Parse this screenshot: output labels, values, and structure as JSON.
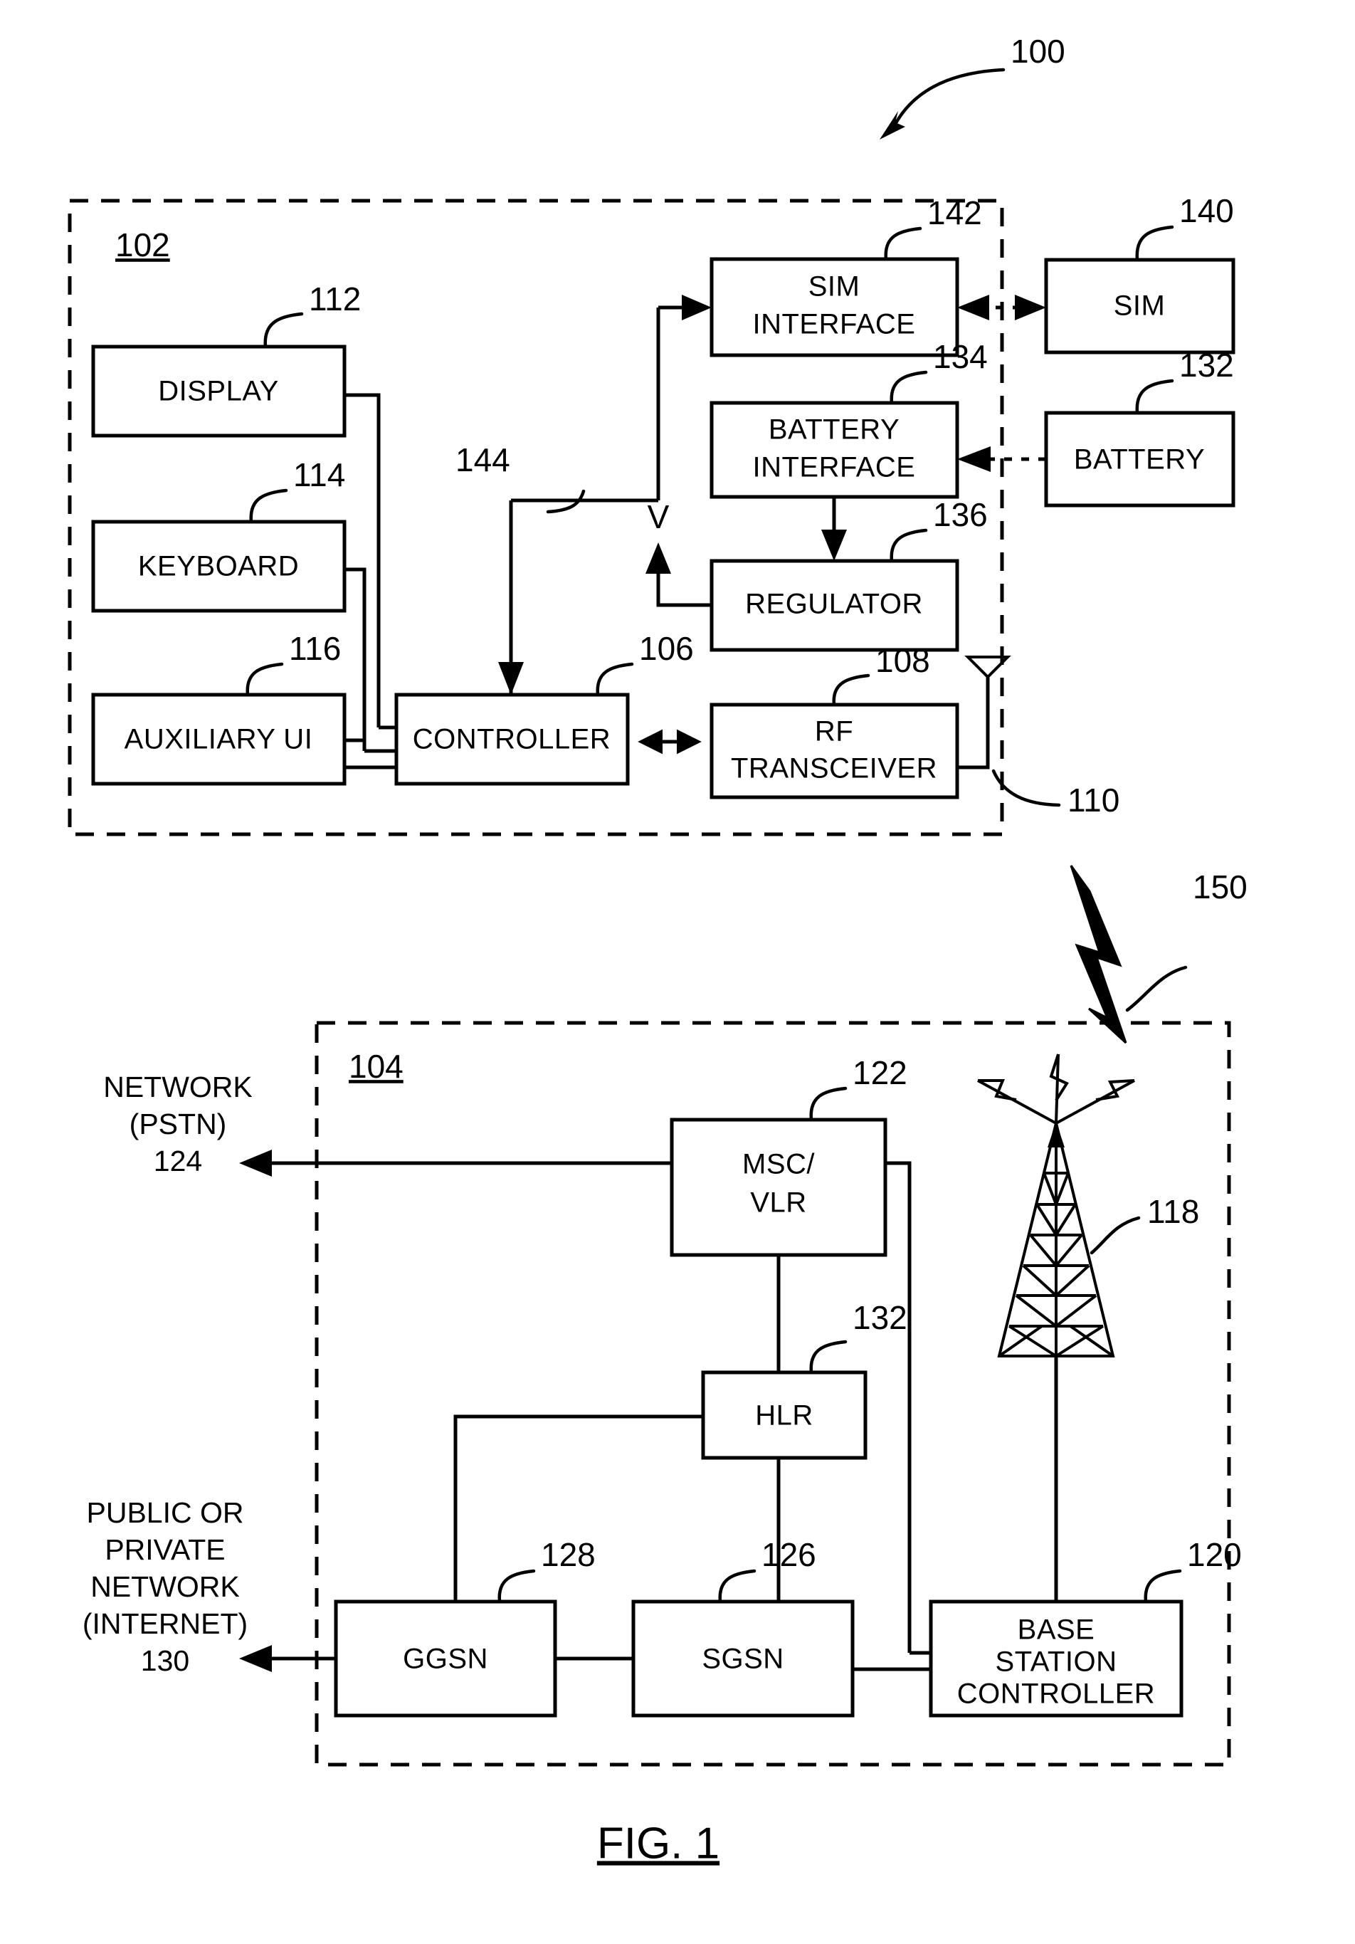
{
  "figure": {
    "caption": "FIG. 1",
    "system_ref": "100"
  },
  "mobile_device": {
    "frame_ref": "102",
    "blocks": [
      {
        "id": "display",
        "label": "DISPLAY",
        "ref": "112"
      },
      {
        "id": "keyboard",
        "label": "KEYBOARD",
        "ref": "114"
      },
      {
        "id": "auxiliary_ui",
        "label": "AUXILIARY UI",
        "ref": "116"
      },
      {
        "id": "controller",
        "label": "CONTROLLER",
        "ref": "106"
      },
      {
        "id": "sim_interface",
        "label_line1": "SIM",
        "label_line2": "INTERFACE",
        "ref": "142"
      },
      {
        "id": "battery_interface",
        "label_line1": "BATTERY",
        "label_line2": "INTERFACE",
        "ref": "134"
      },
      {
        "id": "regulator",
        "label": "REGULATOR",
        "ref": "136"
      },
      {
        "id": "rf_transceiver",
        "label_line1": "RF",
        "label_line2": "TRANSCEIVER",
        "ref": "108"
      }
    ],
    "power_bus_ref": "144",
    "power_bus_label": "V",
    "antenna_ref": "110"
  },
  "external": {
    "sim": {
      "label": "SIM",
      "ref": "140"
    },
    "battery": {
      "label": "BATTERY",
      "ref": "132"
    }
  },
  "air_interface": {
    "ref": "150"
  },
  "network": {
    "frame_ref": "104",
    "blocks": [
      {
        "id": "msc_vlr",
        "label_line1": "MSC/",
        "label_line2": "VLR",
        "ref": "122"
      },
      {
        "id": "hlr",
        "label": "HLR",
        "ref": "132"
      },
      {
        "id": "ggsn",
        "label": "GGSN",
        "ref": "128"
      },
      {
        "id": "sgsn",
        "label": "SGSN",
        "ref": "126"
      },
      {
        "id": "base_station_controller",
        "label_line1": "BASE",
        "label_line2": "STATION",
        "label_line3": "CONTROLLER",
        "ref": "120"
      }
    ],
    "tower": {
      "ref": "118"
    },
    "pstn": {
      "line1": "NETWORK",
      "line2": "(PSTN)",
      "ref": "124"
    },
    "internet": {
      "line1": "PUBLIC OR",
      "line2": "PRIVATE",
      "line3": "NETWORK",
      "line4": "(INTERNET)",
      "ref": "130"
    }
  },
  "colors": {
    "ink": "#000000",
    "paper": "#ffffff"
  }
}
